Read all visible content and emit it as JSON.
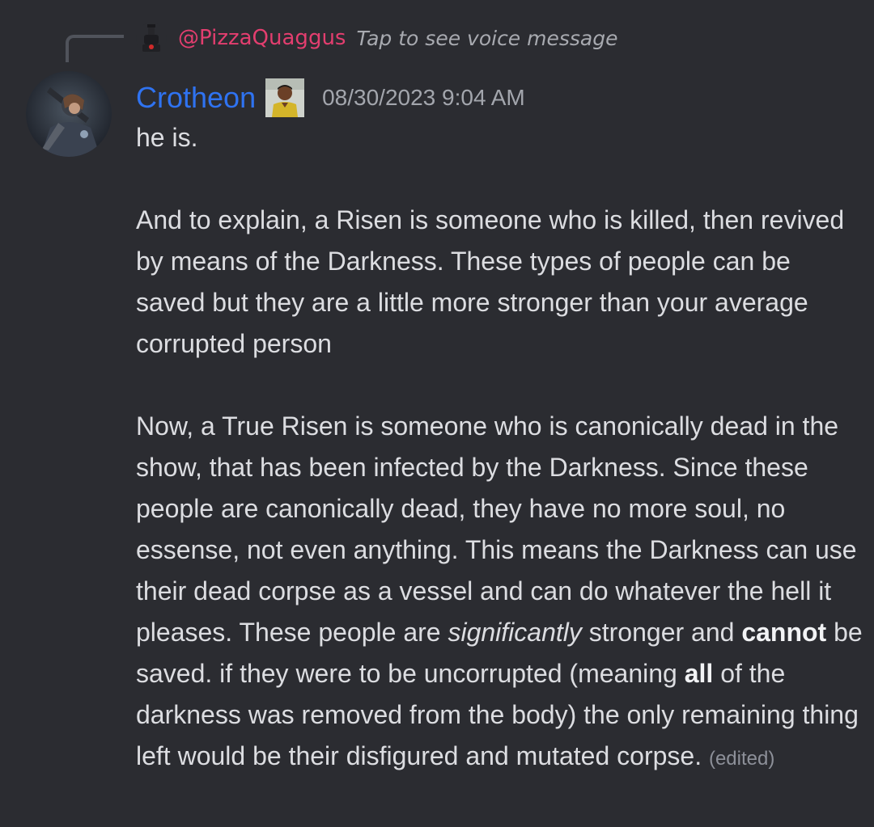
{
  "reply": {
    "author": "@PizzaQuaggus",
    "preview": "Tap to see voice message",
    "avatar_icon": "figure-avatar-icon"
  },
  "message": {
    "author": "Crotheon",
    "timestamp": "08/30/2023 9:04 AM",
    "role_icon": "person-emoji-icon",
    "line_1": "he is.",
    "para_1": "And to explain, a Risen is someone who is killed, then revived by means of the Darkness. These types of people can be saved but they are a little more stronger than your average corrupted person",
    "para_2_part_1": "Now, a True Risen is someone who is canonically dead in the show, that has been infected by the Darkness. Since these people are canonically dead, they have no more soul, no essense, not even anything. This means the Darkness can use their dead corpse as a vessel and can do whatever the hell it pleases. These people are ",
    "para_2_italic": "significantly",
    "para_2_part_2": " stronger and ",
    "para_2_bold_1": "cannot",
    "para_2_part_3": " be saved. if they were to be uncorrupted (meaning ",
    "para_2_bold_2": "all",
    "para_2_part_4": " of the darkness was removed from the body) the only remaining thing left would be their disfigured and mutated corpse.",
    "edited_label": "(edited)"
  },
  "colors": {
    "background": "#2b2c31",
    "reply_author": "#e33e6f",
    "username": "#2f73f1",
    "timestamp": "#a3a6ad",
    "text": "#dcdde1"
  }
}
